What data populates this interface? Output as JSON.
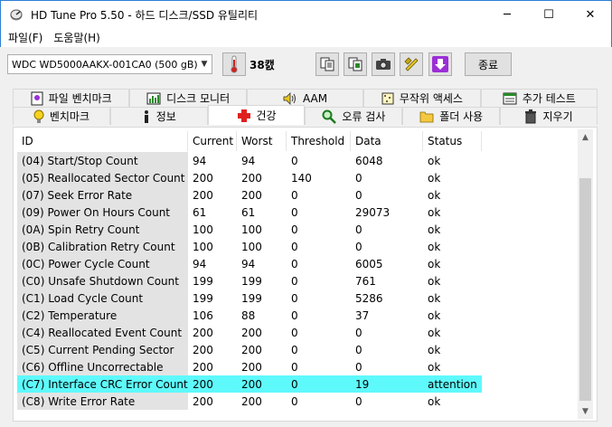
{
  "window": {
    "title": "HD Tune Pro 5.50 - 하드 디스크/SSD 유틸리티",
    "minimize_glyph": "─",
    "maximize_glyph": "☐",
    "close_glyph": "✕"
  },
  "menu": {
    "items": [
      {
        "label": "파일(F)"
      },
      {
        "label": "도움말(H)"
      }
    ]
  },
  "toolbar": {
    "drive": "WDC WD5000AAKX-001CA0 (500 gB)",
    "temperature": "38캜",
    "exit_label": "종료",
    "accent_colors": {
      "download": "#9b2fd6",
      "thermometer": "#d42020"
    }
  },
  "tabs": {
    "row1": [
      {
        "label": "파일 벤치마크",
        "icon": "file-benchmark-icon"
      },
      {
        "label": "디스크 모니터",
        "icon": "disk-monitor-icon"
      },
      {
        "label": "AAM",
        "icon": "speaker-icon"
      },
      {
        "label": "무작위 액세스",
        "icon": "random-access-icon"
      },
      {
        "label": "추가 테스트",
        "icon": "extra-tests-icon"
      }
    ],
    "row2": [
      {
        "label": "벤치마크",
        "icon": "lightbulb-icon"
      },
      {
        "label": "정보",
        "icon": "info-icon"
      },
      {
        "label": "건강",
        "icon": "health-cross-icon"
      },
      {
        "label": "오류 검사",
        "icon": "magnifier-icon"
      },
      {
        "label": "폴더 사용",
        "icon": "folder-icon"
      },
      {
        "label": "지우기",
        "icon": "trash-icon"
      }
    ]
  },
  "health_table": {
    "columns": [
      "ID",
      "Current",
      "Worst",
      "Threshold",
      "Data",
      "Status"
    ],
    "rows": [
      {
        "id": "(04) Start/Stop Count",
        "current": "94",
        "worst": "94",
        "threshold": "0",
        "data": "6048",
        "status": "ok"
      },
      {
        "id": "(05) Reallocated Sector Count",
        "current": "200",
        "worst": "200",
        "threshold": "140",
        "data": "0",
        "status": "ok"
      },
      {
        "id": "(07) Seek Error Rate",
        "current": "200",
        "worst": "200",
        "threshold": "0",
        "data": "0",
        "status": "ok"
      },
      {
        "id": "(09) Power On Hours Count",
        "current": "61",
        "worst": "61",
        "threshold": "0",
        "data": "29073",
        "status": "ok"
      },
      {
        "id": "(0A) Spin Retry Count",
        "current": "100",
        "worst": "100",
        "threshold": "0",
        "data": "0",
        "status": "ok"
      },
      {
        "id": "(0B) Calibration Retry Count",
        "current": "100",
        "worst": "100",
        "threshold": "0",
        "data": "0",
        "status": "ok"
      },
      {
        "id": "(0C) Power Cycle Count",
        "current": "94",
        "worst": "94",
        "threshold": "0",
        "data": "6005",
        "status": "ok"
      },
      {
        "id": "(C0) Unsafe Shutdown Count",
        "current": "199",
        "worst": "199",
        "threshold": "0",
        "data": "761",
        "status": "ok"
      },
      {
        "id": "(C1) Load Cycle Count",
        "current": "199",
        "worst": "199",
        "threshold": "0",
        "data": "5286",
        "status": "ok"
      },
      {
        "id": "(C2) Temperature",
        "current": "106",
        "worst": "88",
        "threshold": "0",
        "data": "37",
        "status": "ok"
      },
      {
        "id": "(C4) Reallocated Event Count",
        "current": "200",
        "worst": "200",
        "threshold": "0",
        "data": "0",
        "status": "ok"
      },
      {
        "id": "(C5) Current Pending Sector",
        "current": "200",
        "worst": "200",
        "threshold": "0",
        "data": "0",
        "status": "ok"
      },
      {
        "id": "(C6) Offline Uncorrectable",
        "current": "200",
        "worst": "200",
        "threshold": "0",
        "data": "0",
        "status": "ok"
      },
      {
        "id": "(C7) Interface CRC Error Count",
        "current": "200",
        "worst": "200",
        "threshold": "0",
        "data": "19",
        "status": "attention",
        "highlight": "#5ef9fb"
      },
      {
        "id": "(C8) Write Error Rate",
        "current": "200",
        "worst": "200",
        "threshold": "0",
        "data": "0",
        "status": "ok"
      }
    ]
  }
}
